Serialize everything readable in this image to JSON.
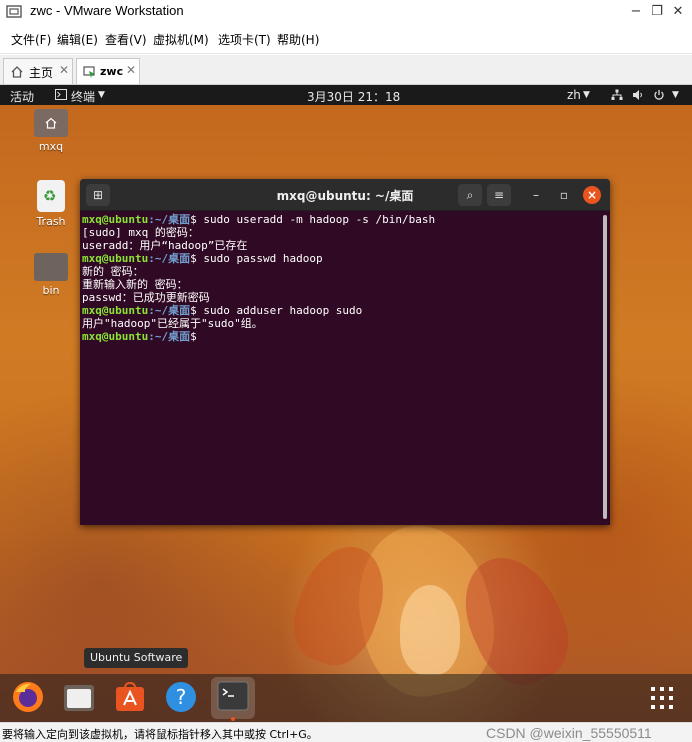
{
  "window": {
    "title": "zwc - VMware Workstation",
    "controls": {
      "minimize": "−",
      "restore": "❐",
      "close": "✕"
    }
  },
  "menubar": {
    "items": [
      "文件(F)",
      "编辑(E)",
      "查看(V)",
      "虚拟机(M)",
      "选项卡(T)",
      "帮助(H)"
    ]
  },
  "tabs": [
    {
      "label": "主页",
      "icon": "home-icon",
      "close": "✕"
    },
    {
      "label": "zwc",
      "icon": "vm-icon",
      "close": "✕"
    }
  ],
  "gnome": {
    "activities": "活动",
    "app_menu": "终端",
    "clock": "3月30日 21：18",
    "input_method": "zh"
  },
  "desktop": {
    "icons": [
      {
        "label": "mxq",
        "icon": "home-folder-icon"
      },
      {
        "label": "Trash",
        "icon": "trash-icon"
      },
      {
        "label": "bin",
        "icon": "folder-icon"
      }
    ]
  },
  "terminal": {
    "title": "mxq@ubuntu: ~/桌面",
    "prompt_user": "mxq@ubuntu",
    "prompt_path": ":~/桌面",
    "prompt_sign": "$",
    "lines": [
      {
        "type": "cmd",
        "text": " sudo useradd -m hadoop -s /bin/bash"
      },
      {
        "type": "out",
        "text": "[sudo] mxq 的密码："
      },
      {
        "type": "out",
        "text": "useradd：用户“hadoop”已存在"
      },
      {
        "type": "cmd",
        "text": " sudo passwd hadoop"
      },
      {
        "type": "out",
        "text": "新的 密码："
      },
      {
        "type": "out",
        "text": "重新输入新的 密码："
      },
      {
        "type": "out",
        "text": "passwd：已成功更新密码"
      },
      {
        "type": "cmd",
        "text": " sudo adduser hadoop sudo"
      },
      {
        "type": "out",
        "text": "用户\"hadoop\"已经属于\"sudo\"组。"
      },
      {
        "type": "cmd",
        "text": ""
      }
    ]
  },
  "dock": {
    "tooltip": "Ubuntu Software",
    "items": [
      "firefox-icon",
      "files-icon",
      "ubuntu-software-icon",
      "help-icon",
      "terminal-icon"
    ]
  },
  "statusbar": {
    "text": "要将输入定向到该虚拟机，请将鼠标指针移入其中或按 Ctrl+G。",
    "watermark": "CSDN @weixin_55550511"
  },
  "colors": {
    "terminal_bg": "#300a24",
    "prompt_user": "#8ae234",
    "prompt_path": "#729fcf",
    "accent": "#e9541f"
  }
}
